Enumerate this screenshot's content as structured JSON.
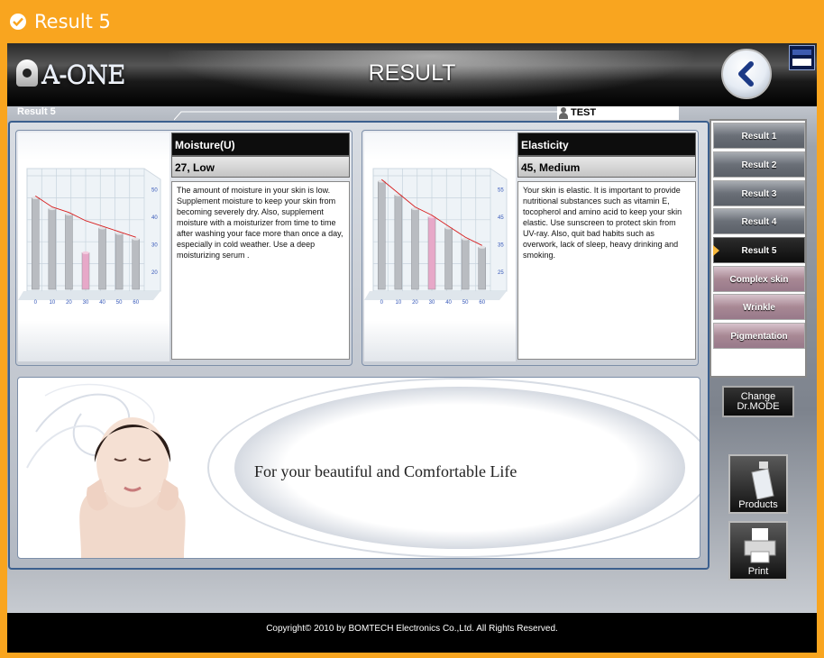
{
  "window": {
    "title": "Result 5"
  },
  "header": {
    "logo": "A-ONE",
    "title": "RESULT"
  },
  "breadcrumb": "Result 5",
  "user": {
    "name": "TEST"
  },
  "cards": [
    {
      "heading": "Moisture(U)",
      "value": "27,  Low",
      "description": "The amount of moisture in your skin is low. Supplement moisture to keep your skin from becoming severely dry. Also, supplement moisture with a moisturizer from time to time after washing your face more than once a day, especially in cold weather. Use a deep moisturizing serum .",
      "chart": {
        "x_ticks": [
          "0",
          "10",
          "20",
          "30",
          "40",
          "50",
          "60"
        ],
        "y_ticks": [
          "50",
          "40",
          "30",
          "20"
        ],
        "highlight_index": 3
      }
    },
    {
      "heading": "Elasticity",
      "value": "45,  Medium",
      "description": "Your skin is elastic. It is important to provide nutritional substances such as vitamin E, tocopherol  and amino acid to keep your skin elastic. Use sunscreen to protect skin from UV-ray. Also, quit bad habits such as overwork, lack of sleep, heavy drinking and smoking.",
      "chart": {
        "x_ticks": [
          "0",
          "10",
          "20",
          "30",
          "40",
          "50",
          "60"
        ],
        "y_ticks": [
          "55",
          "45",
          "35",
          "25"
        ],
        "highlight_index": 3
      }
    }
  ],
  "chart_data": [
    {
      "type": "bar",
      "categories": [
        "0",
        "10",
        "20",
        "30",
        "40",
        "50",
        "60"
      ],
      "values": [
        47,
        43,
        41,
        38,
        36,
        34,
        32
      ],
      "highlight": {
        "category": "30",
        "value": 27
      },
      "ylim": [
        15,
        55
      ]
    },
    {
      "type": "bar",
      "categories": [
        "0",
        "10",
        "20",
        "30",
        "40",
        "50",
        "60"
      ],
      "values": [
        58,
        53,
        48,
        45,
        41,
        37,
        34
      ],
      "highlight": {
        "category": "30",
        "value": 45
      },
      "ylim": [
        20,
        60
      ]
    }
  ],
  "banner": {
    "tagline": "For your beautiful and Comfortable Life"
  },
  "sidebar": {
    "items": [
      {
        "label": "Result 1",
        "style": "gray"
      },
      {
        "label": "Result 2",
        "style": "gray"
      },
      {
        "label": "Result 3",
        "style": "gray"
      },
      {
        "label": "Result 4",
        "style": "gray"
      },
      {
        "label": "Result 5",
        "style": "active"
      },
      {
        "label": "Complex skin",
        "style": "pink"
      },
      {
        "label": "Wrinkle",
        "style": "pink"
      },
      {
        "label": "Pigmentation",
        "style": "pink"
      }
    ]
  },
  "buttons": {
    "drmode_line1": "Change",
    "drmode_line2": "Dr.MODE",
    "products": "Products",
    "print": "Print"
  },
  "footer": {
    "copyright": "Copyright© 2010 by BOMTECH Electronics Co.,Ltd. All Rights Reserved."
  },
  "colors": {
    "window_accent": "#f9a51f",
    "frame_border": "#3b5f8e",
    "highlight_bar": "#e7a8c8",
    "trend_line": "#d81e1e"
  }
}
